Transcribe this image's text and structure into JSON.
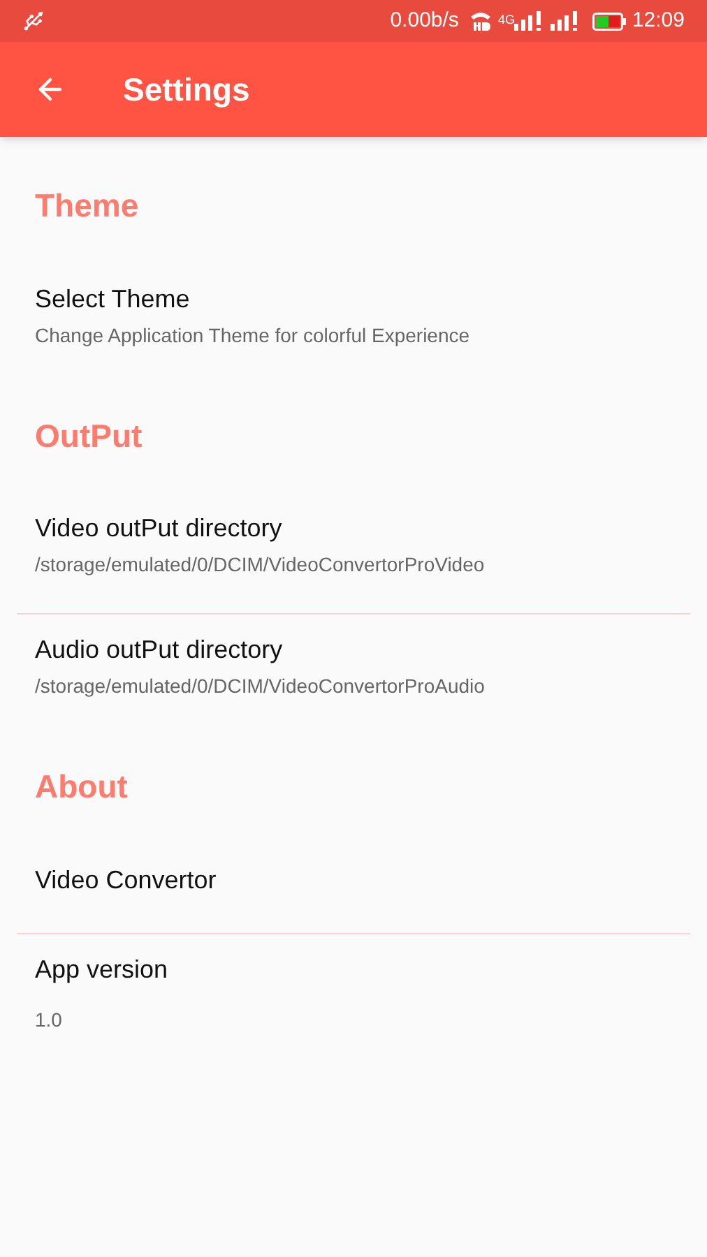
{
  "status_bar": {
    "speed": "0.00b/s",
    "network": "4G",
    "time": "12:09"
  },
  "app_bar": {
    "title": "Settings"
  },
  "sections": [
    {
      "title": "Theme",
      "items": [
        {
          "title": "Select Theme",
          "summary": "Change Application Theme for colorful Experience"
        }
      ]
    },
    {
      "title": "OutPut",
      "items": [
        {
          "title": "Video outPut directory",
          "summary": "/storage/emulated/0/DCIM/VideoConvertorProVideo"
        },
        {
          "title": "Audio outPut directory",
          "summary": "/storage/emulated/0/DCIM/VideoConvertorProAudio"
        }
      ]
    },
    {
      "title": "About",
      "items": [
        {
          "title": "Video Convertor"
        },
        {
          "title": "App version",
          "summary": "1.0"
        }
      ]
    }
  ]
}
